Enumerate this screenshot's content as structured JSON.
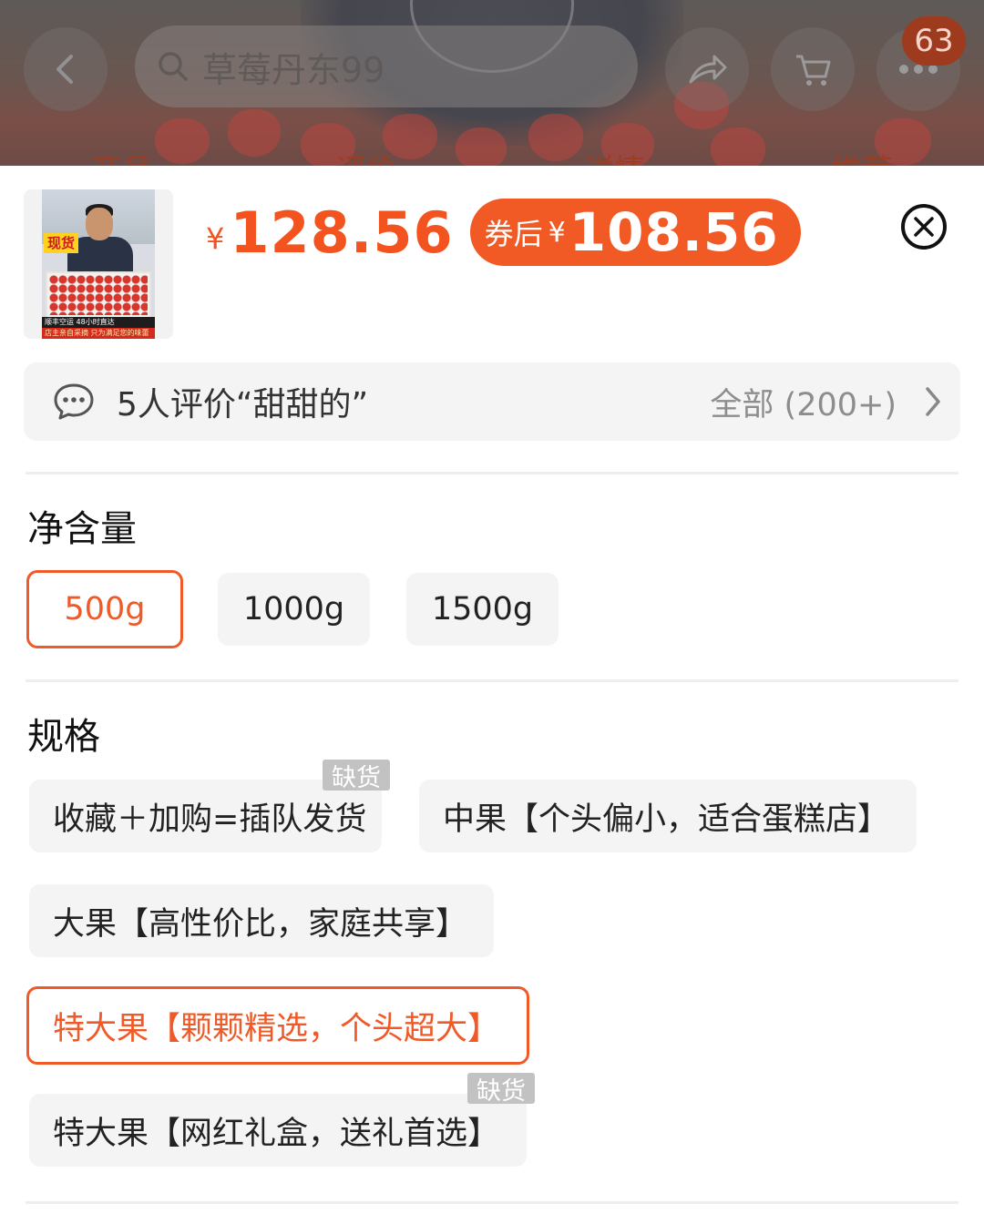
{
  "background_page": {
    "search_placeholder": "草莓丹东99",
    "cart_badge": "63",
    "tabs": [
      "商品",
      "评价",
      "详情",
      "推荐"
    ]
  },
  "thumbnail": {
    "tag": "现货",
    "banner_line1": "顺丰空运  48小时直达",
    "banner_line2": "店主亲自采摘 只为满足您的味蕾"
  },
  "price": {
    "currency": "¥",
    "original": "128.56",
    "coupon_label": "券后",
    "coupon_currency": "¥",
    "coupon_price": "108.56"
  },
  "review": {
    "summary": "5人评价“甜甜的”",
    "all_label": "全部 (200+)"
  },
  "net_weight": {
    "title": "净含量",
    "options": [
      {
        "label": "500g",
        "selected": true
      },
      {
        "label": "1000g",
        "selected": false
      },
      {
        "label": "1500g",
        "selected": false
      }
    ]
  },
  "spec": {
    "title": "规格",
    "out_of_stock_label": "缺货",
    "options": [
      {
        "label": "收藏＋加购=插队发货",
        "selected": false,
        "out_of_stock": true
      },
      {
        "label": "中果【个头偏小，适合蛋糕店】",
        "selected": false,
        "out_of_stock": false
      },
      {
        "label": "大果【高性价比，家庭共享】",
        "selected": false,
        "out_of_stock": false
      },
      {
        "label": "特大果【颗颗精选，个头超大】",
        "selected": true,
        "out_of_stock": false
      },
      {
        "label": "特大果【网红礼盒，送礼首选】",
        "selected": false,
        "out_of_stock": true
      }
    ]
  },
  "colors": {
    "accent": "#f2531f",
    "coupon_bg": "#f25a25",
    "chip_bg": "#f4f4f4",
    "oos_tag_bg": "#c2c2c2"
  }
}
